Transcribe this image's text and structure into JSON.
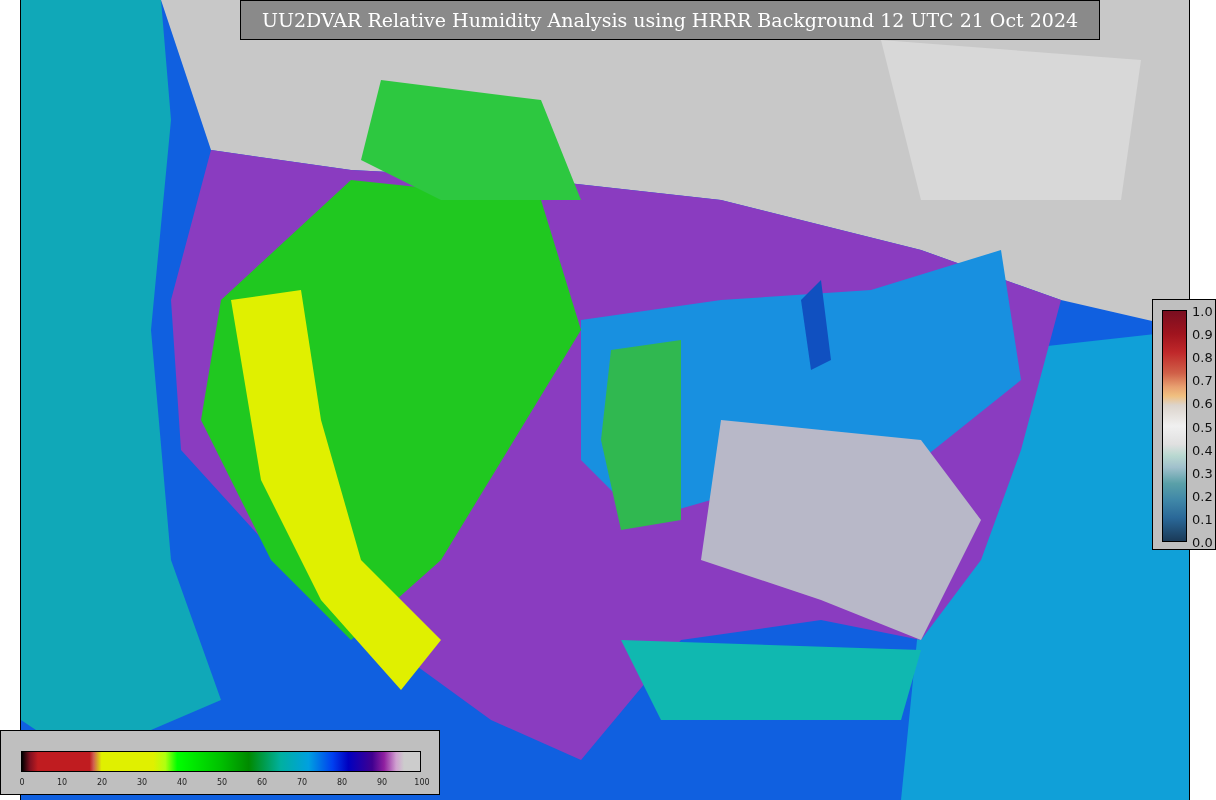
{
  "title": "UU2DVAR Relative Humidity Analysis using HRRR Background 12 UTC 21 Oct 2024",
  "humidity_colorbar": {
    "ticks": [
      "0",
      "10",
      "20",
      "30",
      "40",
      "50",
      "60",
      "70",
      "80",
      "90",
      "100"
    ]
  },
  "ratio_colorbar": {
    "ticks": [
      "1.0",
      "0.9",
      "0.8",
      "0.7",
      "0.6",
      "0.5",
      "0.4",
      "0.3",
      "0.2",
      "0.1",
      "0.0"
    ]
  }
}
